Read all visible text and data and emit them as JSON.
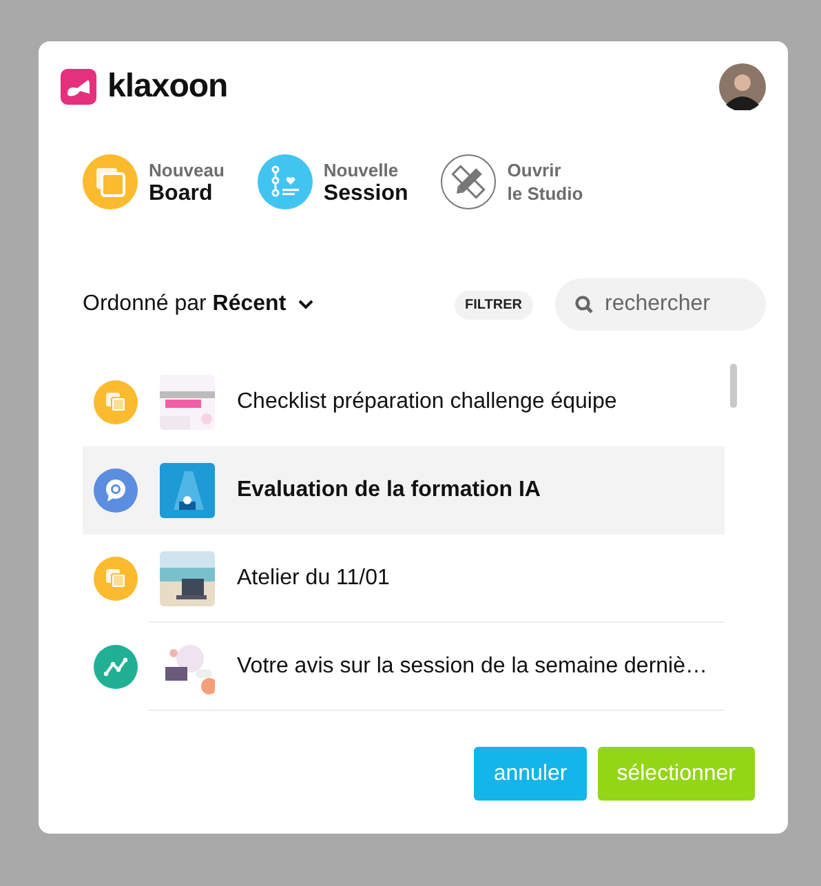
{
  "logo": {
    "text": "klaxoon"
  },
  "actions": [
    {
      "kind": "board",
      "line1": "Nouveau",
      "line2": "Board"
    },
    {
      "kind": "session",
      "line1": "Nouvelle",
      "line2": "Session"
    },
    {
      "kind": "studio",
      "line1": "Ouvrir",
      "line2": "le Studio"
    }
  ],
  "sort": {
    "prefix": "Ordonné par",
    "value": "Récent"
  },
  "filter": {
    "label": "FILTRER"
  },
  "search": {
    "placeholder": "rechercher"
  },
  "items": [
    {
      "kind": "board",
      "title": "Checklist préparation challenge équipe",
      "selected": false
    },
    {
      "kind": "session",
      "title": "Evaluation de la formation IA",
      "selected": true
    },
    {
      "kind": "board",
      "title": "Atelier du 11/01",
      "selected": false
    },
    {
      "kind": "survey",
      "title": "Votre avis sur la session de la semaine derniè…",
      "selected": false
    }
  ],
  "buttons": [
    {
      "kind": "cancel",
      "label": "annuler"
    },
    {
      "kind": "confirm",
      "label": "sélectionner"
    }
  ]
}
